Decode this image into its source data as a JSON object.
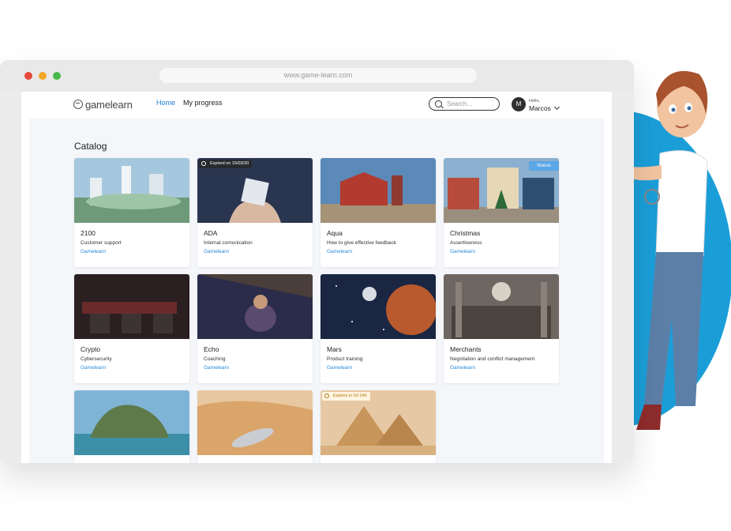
{
  "browser": {
    "url": "www.game-learn.com"
  },
  "nav": {
    "logo": "gamelearn",
    "links": [
      {
        "label": "Home"
      },
      {
        "label": "My progress"
      }
    ],
    "search_placeholder": "Search...",
    "avatar_initial": "M",
    "greeting": "Hello,",
    "user_name": "Marcos"
  },
  "catalog": {
    "title": "Catalog",
    "cards": [
      {
        "name": "2100",
        "topic": "Customer support",
        "provider": "Gamelearn"
      },
      {
        "name": "ADA",
        "topic": "Internal comunication",
        "provider": "Gamelearn",
        "badge": "Expired on 15/03/20"
      },
      {
        "name": "Aqua",
        "topic": "How to give effective feedback",
        "provider": "Gamelearn"
      },
      {
        "name": "Christmas",
        "topic": "Assertiveness",
        "provider": "Gamelearn",
        "badge": "Nuevo"
      },
      {
        "name": "Crypto",
        "topic": "Cybersecurity",
        "provider": "Gamelearn"
      },
      {
        "name": "Echo",
        "topic": "Coaching",
        "provider": "Gamelearn"
      },
      {
        "name": "Mars",
        "topic": "Product training",
        "provider": "Gamelearn"
      },
      {
        "name": "Merchants",
        "topic": "Negotiation and conflict management",
        "provider": "Gamelearn"
      },
      {
        "name": "",
        "topic": "",
        "provider": ""
      },
      {
        "name": "",
        "topic": "",
        "provider": ""
      },
      {
        "name": "",
        "topic": "",
        "provider": "",
        "badge": "Expires in 5d 14h"
      }
    ]
  },
  "colors": {
    "accent": "#1d7fd6",
    "circle": "#1b9ed8"
  }
}
